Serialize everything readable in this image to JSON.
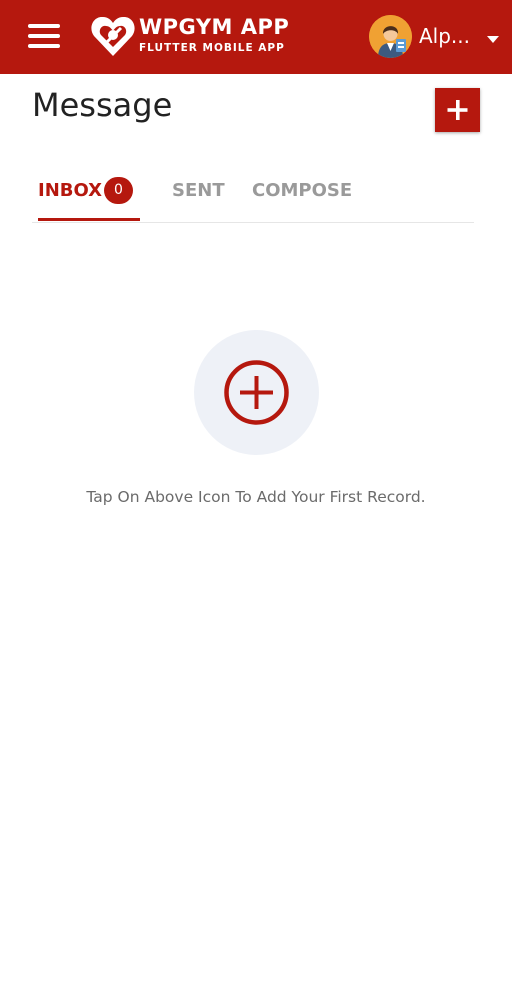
{
  "header": {
    "brand_title": "WPGYM APP",
    "brand_subtitle": "FLUTTER MOBILE APP",
    "user_name": "Alp...",
    "logo_icon": "heart-logo-icon",
    "menu_icon": "hamburger-menu-icon",
    "avatar_icon": "user-avatar-icon",
    "dropdown_icon": "caret-down-icon",
    "background_color": "#b5180e"
  },
  "page": {
    "title": "Message",
    "add_icon": "plus-icon"
  },
  "tabs": [
    {
      "label": "INBOX",
      "badge": "0",
      "active": true
    },
    {
      "label": "SENT",
      "active": false
    },
    {
      "label": "COMPOSE",
      "active": false
    }
  ],
  "empty_state": {
    "icon": "circle-plus-icon",
    "message": "Tap On Above Icon To Add Your First Record."
  },
  "colors": {
    "accent": "#b5180e",
    "inactive_tab": "#9a9a9a",
    "empty_icon_bg": "#eef1f7"
  }
}
